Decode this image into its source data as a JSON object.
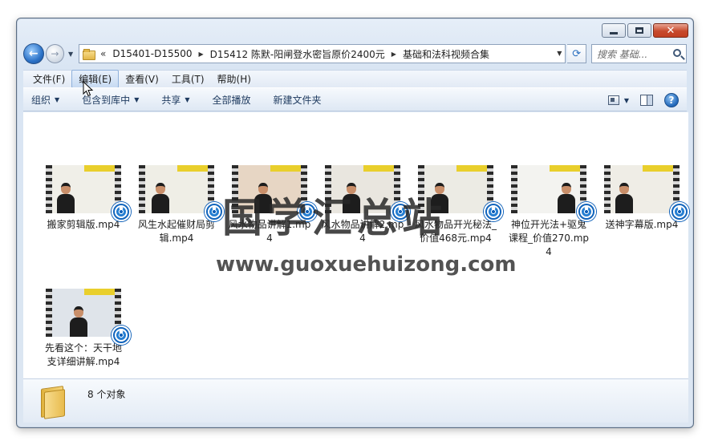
{
  "window": {
    "caption": {
      "minimize": "minimize",
      "maximize": "maximize",
      "close": "close"
    }
  },
  "address": {
    "chevron": "«",
    "crumbs": [
      "D15401-D15500",
      "D15412 陈默-阳闸登水密旨原价2400元",
      "基础和法科视频合集"
    ],
    "search_placeholder": "搜索 基础..."
  },
  "menu": {
    "items": [
      "文件(F)",
      "编辑(E)",
      "查看(V)",
      "工具(T)",
      "帮助(H)"
    ],
    "active_index": 1
  },
  "commands": {
    "organize": "组织",
    "include_in_library": "包含到库中",
    "share": "共享",
    "play_all": "全部播放",
    "new_folder": "新建文件夹"
  },
  "files": [
    {
      "name": "搬家剪辑版.mp4",
      "thumb_color": "#f0efe8"
    },
    {
      "name": "风生水起催财局剪辑.mp4",
      "thumb_color": "#efeee6"
    },
    {
      "name": "风水物品讲解1.mp4",
      "thumb_color": "#e7d6c4"
    },
    {
      "name": "风水物品讲解2.mp4",
      "thumb_color": "#e9e6df"
    },
    {
      "name": "风水物品开光秘法_价值468元.mp4",
      "thumb_color": "#ecebe4"
    },
    {
      "name": "神位开光法+驱鬼课程_价值270.mp4",
      "thumb_color": "#f3f3f0"
    },
    {
      "name": "送神字幕版.mp4",
      "thumb_color": "#efede6"
    },
    {
      "name": "先看这个：天干地支详细讲解.mp4",
      "thumb_color": "#dfe4ea"
    }
  ],
  "watermark": {
    "cn": "国学汇总站",
    "url": "www.guoxuehuizong.com"
  },
  "details": {
    "count": "8 个对象"
  }
}
